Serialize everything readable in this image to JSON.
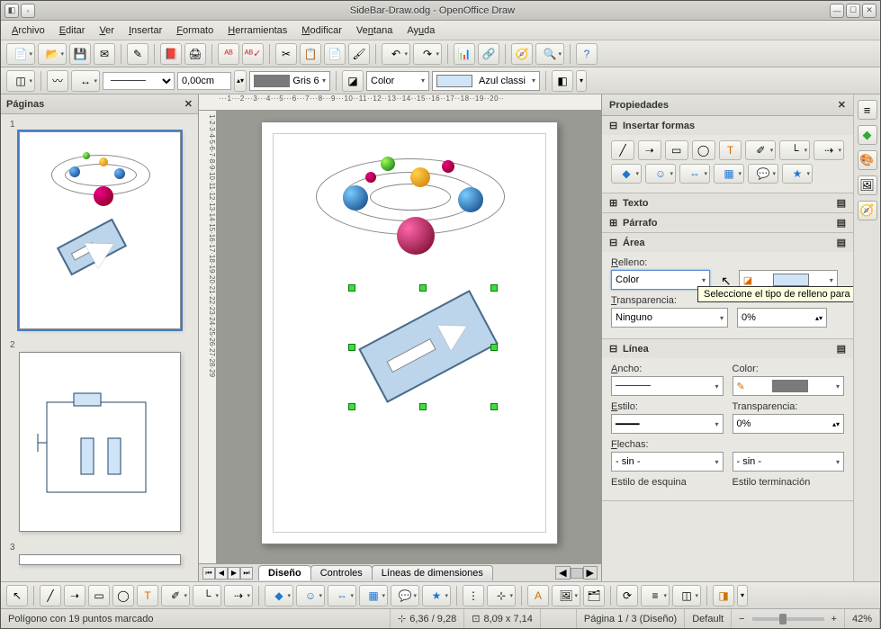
{
  "window": {
    "title": "SideBar-Draw.odg - OpenOffice Draw"
  },
  "menus": [
    "Archivo",
    "Editar",
    "Ver",
    "Insertar",
    "Formato",
    "Herramientas",
    "Modificar",
    "Ventana",
    "Ayuda"
  ],
  "toolbar2": {
    "width_value": "0,00cm",
    "line_color_label": "Gris 6",
    "fill_type": "Color",
    "fill_color_label": "Azul classi"
  },
  "pages_panel": {
    "title": "Páginas",
    "thumbs": [
      "1",
      "2",
      "3"
    ]
  },
  "ruler_h": "···1···2···3···4···5···6···7···8···9···10··11··12··13··14··15··16··17··18··19··20··",
  "ruler_v": "1·2·3·4·5·6·7·8·9·10·11·12·13·14·15·16·17·18·19·20·21·22·23·24·25·26·27·28·29",
  "tabs": {
    "design": "Diseño",
    "controls": "Controles",
    "dims": "Líneas de dimensiones"
  },
  "sidebar": {
    "title": "Propiedades",
    "shapes_title": "Insertar formas",
    "text_title": "Texto",
    "para_title": "Párrafo",
    "area": {
      "title": "Área",
      "fill_label": "Relleno:",
      "fill_value": "Color",
      "trans_label": "Transparencia:",
      "trans_type": "Ninguno",
      "trans_value": "0%"
    },
    "line": {
      "title": "Línea",
      "width_label": "Ancho:",
      "color_label": "Color:",
      "style_label": "Estilo:",
      "trans_label": "Transparencia:",
      "trans_value": "0%",
      "arrows_label": "Flechas:",
      "arrow_none": "- sin -",
      "corner_label": "Estilo de esquina",
      "end_label": "Estilo terminación"
    }
  },
  "tooltip": "Seleccione el tipo de relleno para aplicar.",
  "status": {
    "selection": "Polígono con 19 puntos marcado",
    "pos": "6,36 / 9,28",
    "size": "8,09 x 7,14",
    "page": "Página 1 / 3 (Diseño)",
    "style": "Default",
    "zoom": "42%"
  }
}
